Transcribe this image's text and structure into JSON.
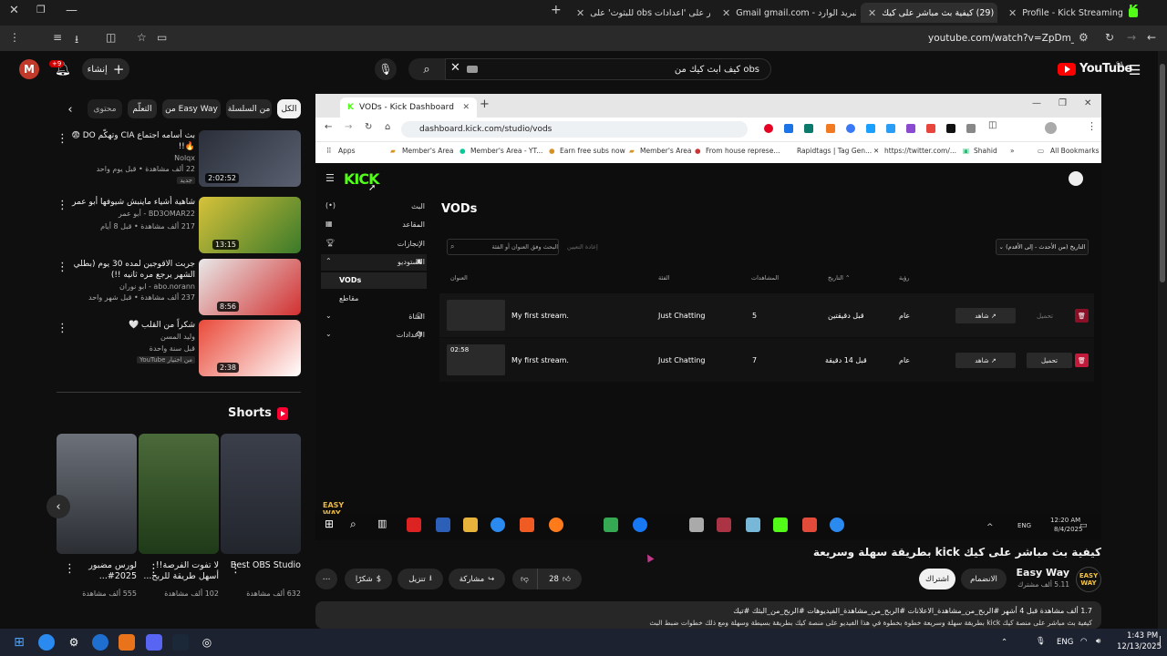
{
  "browser": {
    "tabs": [
      {
        "label": "Profile - Kick Streaming",
        "active": false
      },
      {
        "label": "(29) كيفية بث مباشر على كيك",
        "active": true
      },
      {
        "label": "البريد الوارد - Gmail gmail.com",
        "active": false
      },
      {
        "label": "اعثر على 'اعدادات obs للبثوث' على",
        "active": false
      }
    ],
    "url": "youtube.com/watch?v=ZpDm_L8RXho"
  },
  "youtube": {
    "avatar_letter": "M",
    "notifications": "+9",
    "create_label": "إنشاء",
    "search_query": "كيف ابث كيك من obs",
    "logo_text": "YouTube",
    "logo_region": "SA",
    "chips": [
      "الكل",
      "من السلسلة",
      "من Easy Way",
      "التعلّم",
      "محتوى"
    ],
    "related": [
      {
        "title": "بث أسامه اجتماع CIA وتهكّم DO 😨 🔥!!",
        "channel": "Nolqx",
        "meta": "22 ألف مشاهدة • قبل يوم واحد",
        "badge": "جديد",
        "duration": "2:02:52",
        "c1": "#2a2f3a",
        "c2": "#5a6070"
      },
      {
        "title": "شاهية أشياء ماينبش شيوفها أبو عمر",
        "channel": "BD3OMAR22 - أبو عمر",
        "meta": "217 ألف مشاهدة • قبل 8 أيام",
        "badge": "",
        "duration": "13:15",
        "c1": "#d7c23a",
        "c2": "#3a7a2a"
      },
      {
        "title": "جربت الاقوجين لمده 30 يوم (بطلي الشهر يرجع مره ثانيه !!)",
        "channel": "abo.norann - ابو نوران",
        "meta": "237 ألف مشاهدة • قبل شهر واحد",
        "badge": "",
        "duration": "8:56",
        "c1": "#e8e8e8",
        "c2": "#d23030"
      },
      {
        "title": "شكراً من القلب 🤍",
        "channel": "وليد المسن",
        "meta": "قبل سنة واحدة",
        "badge": "YouTube من اختيار",
        "duration": "2:38",
        "c1": "#e94a3a",
        "c2": "#ffffff"
      }
    ],
    "shorts_label": "Shorts",
    "shorts": [
      {
        "title": "Best OBS Studio",
        "views": "632 ألف مشاهدة"
      },
      {
        "title": "لا تفوت الفرصة!! أسهل طريقة للربح...",
        "views": "102 ألف مشاهدة"
      },
      {
        "title": "لورس مضبور 2025#...",
        "views": "555 ألف مشاهدة"
      }
    ],
    "video": {
      "title": "كيفية بث مباشر على كيك kick بطريقة سهلة وسريعة",
      "channel": "Easy Way",
      "subs": "5.11 ألف مشترك",
      "join_label": "الانضمام",
      "subscribe_label": "اشتراك",
      "likes": "28",
      "share_label": "مشاركة",
      "download_label": "تنزيل",
      "thanks_label": "شكرًا",
      "desc_line1": "1.7 ألف مشاهدة قبل 4 أشهر #الربح_من_مشاهدة_الاعلانات #الربح_من_مشاهدة_الفيديوهات #الربح_من_البثك #تيك",
      "desc_line2": "كيفية بث مباشر على منصة كيك kick بطريقة سهلة وسريعة خطوة بخطوة في هذا الفيديو على منصة كيك بطريقة بسيطة وسهلة ومع ذلك خطوات ضبط البث"
    }
  },
  "kick": {
    "tab_title": "VODs - Kick Dashboard",
    "url": "dashboard.kick.com/studio/vods",
    "bookmarks": [
      "Apps",
      "Member's Area",
      "Member's Area - YT...",
      "Earn free subs now",
      "Member's Area",
      "From house represe...",
      "Rapidtags | Tag Gen...",
      "https://twitter.com/...",
      "Shahid",
      "All Bookmarks"
    ],
    "logo": "KICK",
    "nav": [
      "البث",
      "المقاعد",
      "الإنجازات",
      "الاستوديو",
      "VODs",
      "مقاطع",
      "القناة",
      "الإعدادات"
    ],
    "page_title": "VODs",
    "search_placeholder": "البحث وفق العنوان أو الفئة",
    "reset_label": "إعادة التعيين",
    "sort_label": "التاريخ (من الأحدث - إلى الأقدم)",
    "headers": {
      "title": "العنوان",
      "category": "الفئة",
      "views": "المشاهدات",
      "date": "التاريخ",
      "visibility": "رؤية"
    },
    "rows": [
      {
        "title": "My first stream.",
        "category": "Just Chatting",
        "views": "5",
        "date": "قبل دقيقتين",
        "visibility": "عام",
        "watch": "شاهد",
        "download": "تحميل",
        "duration": ""
      },
      {
        "title": "My first stream.",
        "category": "Just Chatting",
        "views": "7",
        "date": "قبل 14 دقيقة",
        "visibility": "عام",
        "watch": "شاهد",
        "download": "تحميل",
        "duration": "02:58"
      }
    ],
    "watermark": "EASY WAY",
    "tray_lang": "ENG",
    "tray_time": "12:20 AM",
    "tray_date": "8/4/2025"
  },
  "os": {
    "lang": "ENG",
    "time": "1:43 PM",
    "date": "12/13/2025"
  }
}
